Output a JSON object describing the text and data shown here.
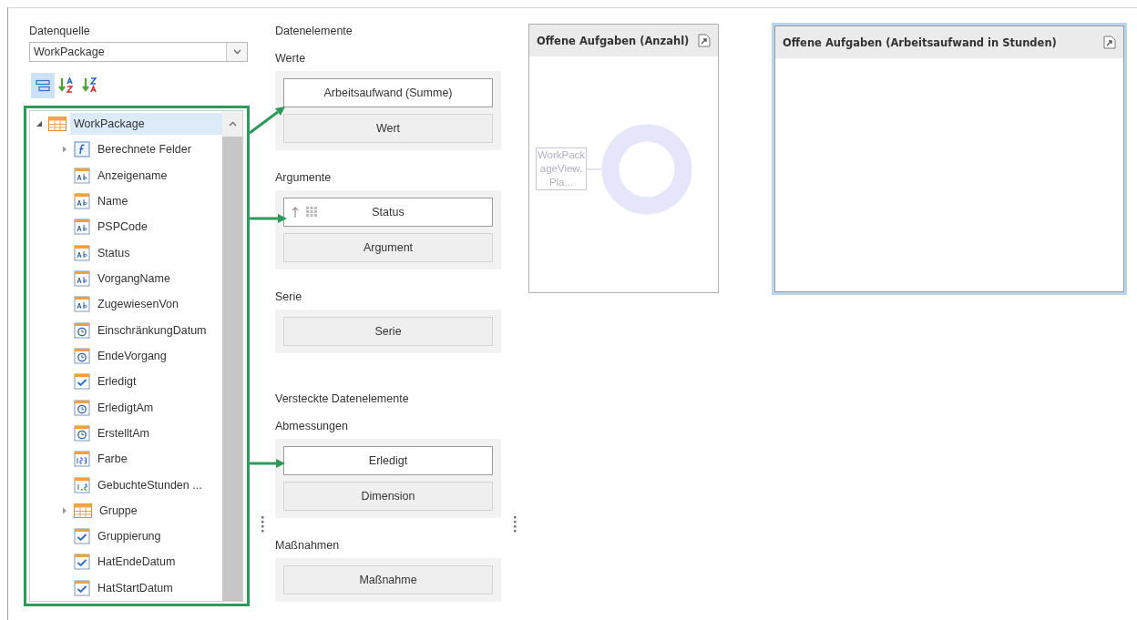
{
  "data_source": {
    "label": "Datenquelle",
    "value": "WorkPackage"
  },
  "sort_toolbar": [
    {
      "kind": "group",
      "selected": true
    },
    {
      "kind": "sort_asc",
      "selected": false
    },
    {
      "kind": "sort_desc",
      "selected": false
    }
  ],
  "field_tree": [
    {
      "label": "WorkPackage",
      "kind": "table",
      "expanded": true,
      "selected": true,
      "children": [
        {
          "label": "Berechnete Felder",
          "kind": "formula",
          "expanded": false,
          "selected": false
        },
        {
          "label": "Anzeigename",
          "kind": "text",
          "selected": false
        },
        {
          "label": "Name",
          "kind": "text",
          "selected": false
        },
        {
          "label": "PSPCode",
          "kind": "text",
          "selected": false
        },
        {
          "label": "Status",
          "kind": "text",
          "selected": false
        },
        {
          "label": "VorgangName",
          "kind": "text",
          "selected": false
        },
        {
          "label": "ZugewiesenVon",
          "kind": "text",
          "selected": false
        },
        {
          "label": "EinschränkungDatum",
          "kind": "date",
          "selected": false
        },
        {
          "label": "EndeVorgang",
          "kind": "date",
          "selected": false
        },
        {
          "label": "Erledigt",
          "kind": "bool",
          "selected": false
        },
        {
          "label": "ErledigtAm",
          "kind": "date",
          "selected": false
        },
        {
          "label": "ErstelltAm",
          "kind": "date",
          "selected": false
        },
        {
          "label": "Farbe",
          "kind": "number",
          "selected": false
        },
        {
          "label": "GebuchteStunden ...",
          "kind": "decimal",
          "selected": false
        },
        {
          "label": "Gruppe",
          "kind": "table",
          "expanded": false,
          "selected": false
        },
        {
          "label": "Gruppierung",
          "kind": "bool",
          "selected": false
        },
        {
          "label": "HatEndeDatum",
          "kind": "bool",
          "selected": false
        },
        {
          "label": "HatStartDatum",
          "kind": "bool",
          "selected": false
        }
      ]
    }
  ],
  "data_items": {
    "title": "Datenelemente",
    "sections": [
      {
        "label": "Werte",
        "slots": [
          {
            "kind": "field",
            "text": "Arbeitsaufwand (Summe)",
            "sorted": false
          },
          {
            "kind": "placeholder",
            "text": "Wert"
          }
        ]
      },
      {
        "label": "Argumente",
        "slots": [
          {
            "kind": "field",
            "text": "Status",
            "sorted": true
          },
          {
            "kind": "placeholder",
            "text": "Argument"
          }
        ]
      },
      {
        "label": "Serie",
        "slots": [
          {
            "kind": "placeholder",
            "text": "Serie"
          }
        ]
      }
    ]
  },
  "hidden_items": {
    "title": "Versteckte Datenelemente",
    "sections": [
      {
        "label": "Abmessungen",
        "slots": [
          {
            "kind": "field",
            "text": "Erledigt",
            "sorted": false
          },
          {
            "kind": "placeholder",
            "text": "Dimension"
          }
        ]
      },
      {
        "label": "Maßnahmen",
        "slots": [
          {
            "kind": "placeholder",
            "text": "Maßnahme"
          }
        ]
      }
    ]
  },
  "charts": [
    {
      "title": "Offene Aufgaben (Anzahl)",
      "kind": "donut",
      "selected": false,
      "label": "WorkPackageView.Pla..."
    },
    {
      "title": "Offene Aufgaben (Arbeitsaufwand in Stunden)",
      "kind": "empty",
      "selected": true
    }
  ]
}
